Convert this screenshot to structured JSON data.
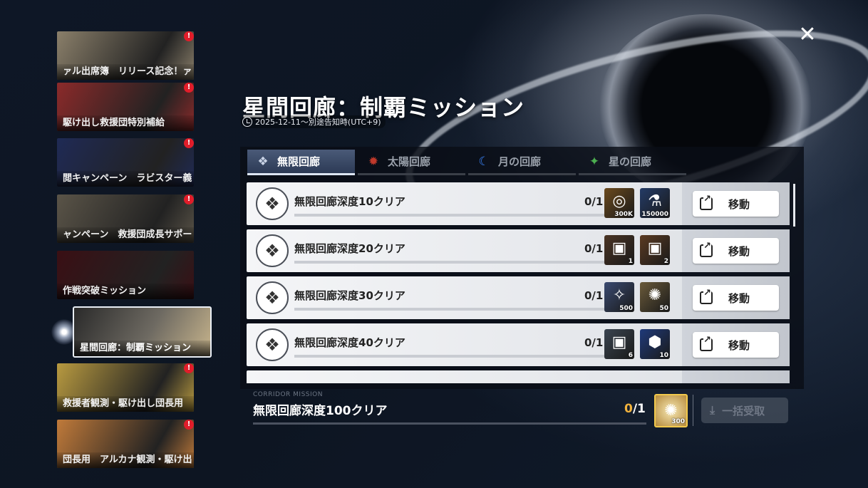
{
  "event": {
    "title": "星間回廊：制覇ミッション",
    "period": "2025-12-11～別途告知時(UTC+9)"
  },
  "sidebar": {
    "items": [
      {
        "label": "ァル出席簿　リリース記念！ァ",
        "badge": "!",
        "bg": "#8a7f6a"
      },
      {
        "label": "駆け出し救援団特別補給",
        "badge": "!",
        "bg": "#8b2a2a"
      },
      {
        "label": "閲キャンペーン　ラビスター義",
        "badge": "!",
        "bg": "#1f2a55"
      },
      {
        "label": "ャンペーン　救援団成長サポー",
        "badge": "!",
        "bg": "#5a5448"
      },
      {
        "label": "作戦突破ミッション",
        "badge": "",
        "bg": "#3a0f14"
      },
      {
        "label": "救援者観測・駆け出し団長用",
        "badge": "!",
        "bg": "#b89a40"
      },
      {
        "label": "団長用　アルカナ観測・駆け出",
        "badge": "!",
        "bg": "#c07a3a"
      }
    ],
    "active": {
      "label": "星間回廊：制覇ミッション"
    }
  },
  "tabs": [
    {
      "label": "無限回廊",
      "icon": "infinity-icon",
      "glyph": "❖",
      "color": "#c9d3e6"
    },
    {
      "label": "太陽回廊",
      "icon": "sun-icon",
      "glyph": "✹",
      "color": "#c0392b"
    },
    {
      "label": "月の回廊",
      "icon": "moon-icon",
      "glyph": "☾",
      "color": "#3b82f6"
    },
    {
      "label": "星の回廊",
      "icon": "star-icon",
      "glyph": "✦",
      "color": "#4caf50"
    }
  ],
  "missions": [
    {
      "name": "無限回廊深度10クリア",
      "progress": "0/1",
      "rewards": [
        {
          "icon": "gold-coin-icon",
          "glyph": "◎",
          "qty": "300K",
          "bg": "#6b4a1e"
        },
        {
          "icon": "potion-icon",
          "glyph": "⚗",
          "qty": "150000",
          "bg": "#243b66"
        }
      ],
      "action": "移動"
    },
    {
      "name": "無限回廊深度20クリア",
      "progress": "0/1",
      "rewards": [
        {
          "icon": "chest-icon",
          "glyph": "▣",
          "qty": "1",
          "bg": "#4a3424"
        },
        {
          "icon": "chest-icon",
          "glyph": "▣",
          "qty": "2",
          "bg": "#5a3a22"
        }
      ],
      "action": "移動"
    },
    {
      "name": "無限回廊深度30クリア",
      "progress": "0/1",
      "rewards": [
        {
          "icon": "crystal-icon",
          "glyph": "✧",
          "qty": "500",
          "bg": "#3a4a70"
        },
        {
          "icon": "medal-icon",
          "glyph": "✺",
          "qty": "50",
          "bg": "#6a5a3a"
        }
      ],
      "action": "移動"
    },
    {
      "name": "無限回廊深度40クリア",
      "progress": "0/1",
      "rewards": [
        {
          "icon": "chest-icon",
          "glyph": "▣",
          "qty": "6",
          "bg": "#3a4450"
        },
        {
          "icon": "gem-icon",
          "glyph": "⬢",
          "qty": "10",
          "bg": "#1f3a7a"
        }
      ],
      "action": "移動"
    }
  ],
  "bottom": {
    "caption": "CORRIDOR MISSION",
    "name": "無限回廊深度100クリア",
    "current": "0",
    "total": "/1",
    "reward_qty": "300",
    "claim_all": "一括受取"
  },
  "close": "✕"
}
